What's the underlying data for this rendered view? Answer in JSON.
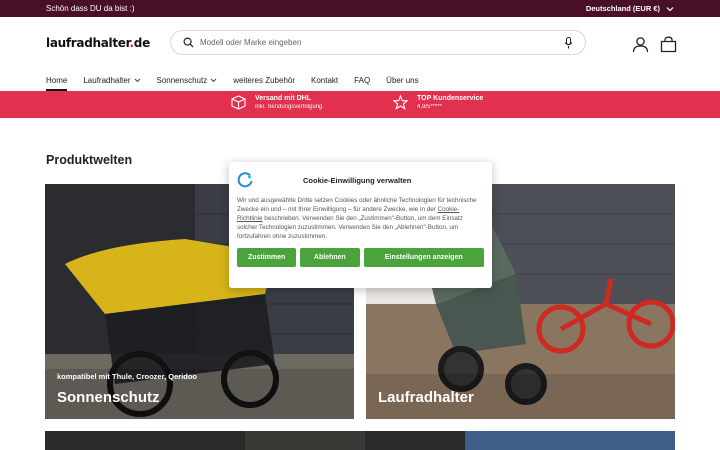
{
  "topbar": {
    "greeting": "Schön dass DU da bist :)",
    "region": "Deutschland (EUR €)"
  },
  "header": {
    "logo_main": "laufradhalter",
    "logo_dot": ".",
    "logo_tld": "de",
    "search_placeholder": "Modell oder Marke eingeben"
  },
  "nav": {
    "items": [
      {
        "label": "Home"
      },
      {
        "label": "Laufradhalter"
      },
      {
        "label": "Sonnenschutz"
      },
      {
        "label": "weiteres Zubehör"
      },
      {
        "label": "Kontakt"
      },
      {
        "label": "FAQ"
      },
      {
        "label": "Über uns"
      }
    ]
  },
  "promo": {
    "shipping_title": "Versand mit DHL",
    "shipping_sub": "inkl. Sendungsverfolgung",
    "service_title": "TOP Kundenservice",
    "service_sub": "4,9/5*****"
  },
  "main": {
    "section_title": "Produktwelten",
    "tiles": [
      {
        "small": "kompatibel mit Thule, Croozer, Qeridoo",
        "big": "Sonnenschutz"
      },
      {
        "small": "",
        "big": "Laufradhalter"
      }
    ]
  },
  "cookie": {
    "title": "Cookie-Einwilligung verwalten",
    "text_1": "Wir und ausgewählte Dritte setzen Cookies oder ähnliche Technologien für technische Zwecke ein und – mit Ihrer Einwilligung – für andere Zwecke, wie in der ",
    "link": "Cookie-Richtlinie",
    "text_2": " beschrieben. Verwenden Sie den „Zustimmen\"-Button, um dem Einsatz solcher Technologien zuzustimmen. Verwenden Sie den „Ablehnen\"-Button, um fortzufahren ohne zuzustimmen.",
    "accept": "Zustimmen",
    "reject": "Ablehnen",
    "settings": "Einstellungen anzeigen"
  },
  "colors": {
    "topbar": "#4a0f28",
    "promo": "#e2304f",
    "button": "#4aa43b",
    "logo_dot": "#e0193f"
  }
}
